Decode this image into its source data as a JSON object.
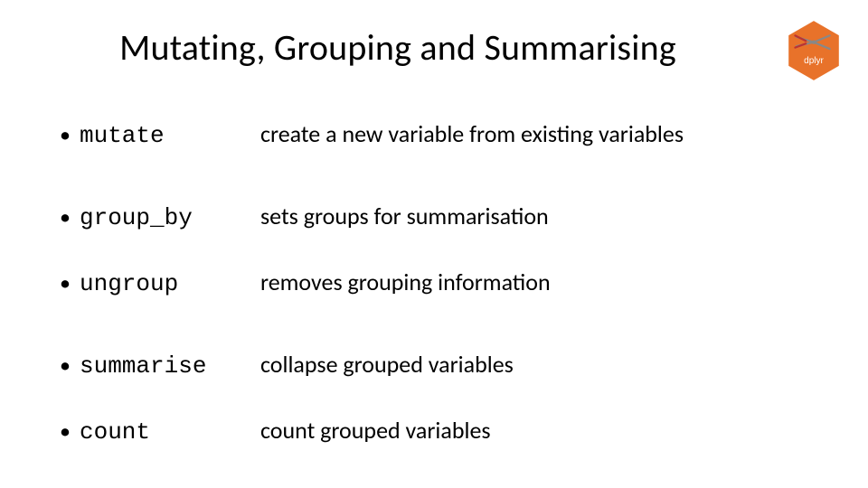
{
  "title": "Mutating, Grouping and Summarising",
  "logo": {
    "label": "dplyr"
  },
  "items": [
    {
      "term": "mutate",
      "desc": "create a new variable from existing variables",
      "gap": "large"
    },
    {
      "term": "group_by",
      "desc": "sets groups for summarisation",
      "gap": "med"
    },
    {
      "term": "ungroup",
      "desc": "removes grouping information",
      "gap": "large"
    },
    {
      "term": "summarise",
      "desc": "collapse grouped variables",
      "gap": "med"
    },
    {
      "term": "count",
      "desc": "count grouped variables",
      "gap": "small"
    }
  ],
  "bullet": "•"
}
